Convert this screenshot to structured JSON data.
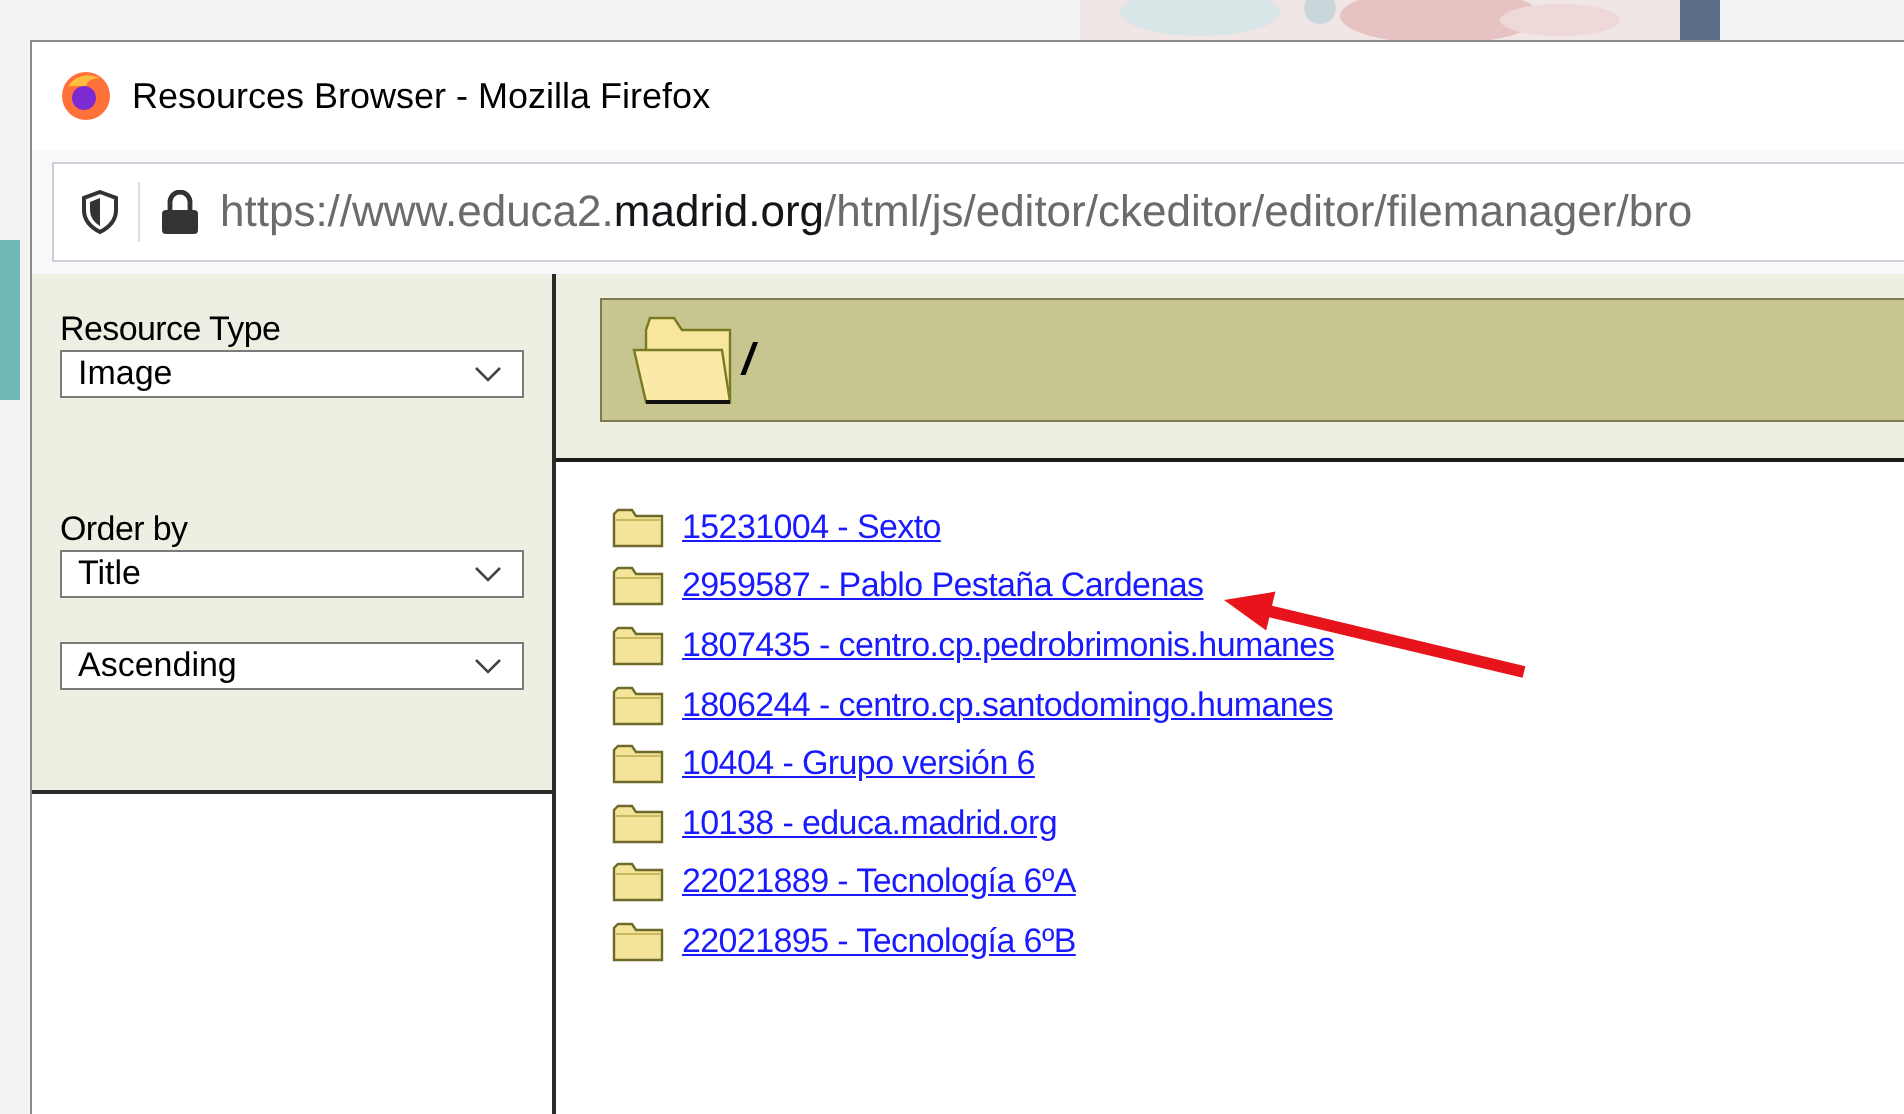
{
  "window": {
    "title": "Resources Browser - Mozilla Firefox"
  },
  "address_bar": {
    "url_prefix": "https://www.educa2.",
    "url_domain": "madrid.org",
    "url_path": "/html/js/editor/ckeditor/editor/filemanager/bro"
  },
  "sidebar": {
    "resource_type": {
      "label": "Resource Type",
      "value": "Image"
    },
    "order_by": {
      "label": "Order by",
      "value": "Title"
    },
    "direction": {
      "value": "Ascending"
    }
  },
  "current_folder": {
    "path": "/"
  },
  "folders": [
    {
      "label": "15231004 - Sexto"
    },
    {
      "label": "2959587 - Pablo Pestaña Cardenas"
    },
    {
      "label": "1807435 - centro.cp.pedrobrimonis.humanes"
    },
    {
      "label": "1806244 - centro.cp.santodomingo.humanes"
    },
    {
      "label": "10404 - Grupo versión 6"
    },
    {
      "label": "10138 - educa.madrid.org"
    },
    {
      "label": "22021889 - Tecnología 6ºA"
    },
    {
      "label": "22021895 - Tecnología 6ºB"
    }
  ]
}
